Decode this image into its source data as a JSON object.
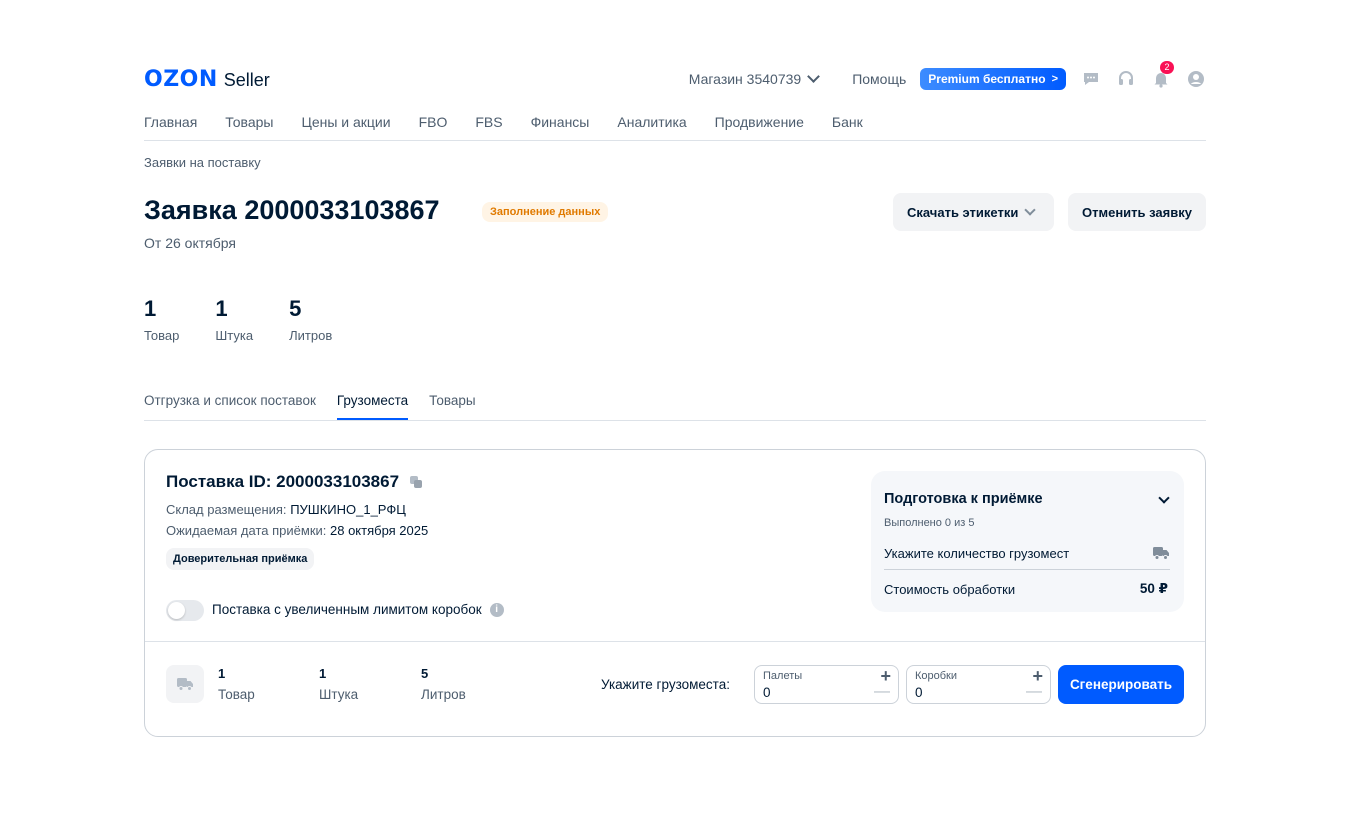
{
  "header": {
    "logo_brand": "OZON",
    "logo_product": "Seller",
    "store": "Магазин 3540739",
    "help": "Помощь",
    "premium": "Premium бесплатно",
    "notification_count": "2"
  },
  "nav": [
    "Главная",
    "Товары",
    "Цены и акции",
    "FBO",
    "FBS",
    "Финансы",
    "Аналитика",
    "Продвижение",
    "Банк"
  ],
  "breadcrumb": "Заявки на поставку",
  "page": {
    "title": "Заявка 2000033103867",
    "status": "Заполнение данных",
    "date": "От 26 октября",
    "download_labels": "Скачать этикетки",
    "cancel": "Отменить заявку"
  },
  "stats": [
    {
      "value": "1",
      "label": "Товар"
    },
    {
      "value": "1",
      "label": "Штука"
    },
    {
      "value": "5",
      "label": "Литров"
    }
  ],
  "tabs": [
    {
      "label": "Отгрузка и список поставок",
      "active": false
    },
    {
      "label": "Грузоместа",
      "active": true
    },
    {
      "label": "Товары",
      "active": false
    }
  ],
  "supply": {
    "id_title": "Поставка ID: 2000033103867",
    "warehouse_label": "Склад размещения:",
    "warehouse_value": "ПУШКИНО_1_РФЦ",
    "date_label": "Ожидаемая дата приёмки:",
    "date_value": "28 октября 2025",
    "chip": "Доверительная приёмка",
    "toggle_label": "Поставка с увеличенным лимитом коробок"
  },
  "prep": {
    "title": "Подготовка к приёмке",
    "done": "Выполнено 0 из 5",
    "item": "Укажите количество грузомест",
    "cost_label": "Стоимость обработки",
    "cost_value": "50 ₽"
  },
  "bottom": {
    "stats": [
      {
        "value": "1",
        "label": "Товар"
      },
      {
        "value": "1",
        "label": "Штука"
      },
      {
        "value": "5",
        "label": "Литров"
      }
    ],
    "cargo_label": "Укажите грузоместа:",
    "pallets_label": "Палеты",
    "pallets_value": "0",
    "boxes_label": "Коробки",
    "boxes_value": "0",
    "generate": "Сгенерировать"
  },
  "colors": {
    "accent": "#005bff",
    "status_bg": "#fff4e5",
    "status_text": "#e07a00",
    "badge": "#f91155"
  }
}
